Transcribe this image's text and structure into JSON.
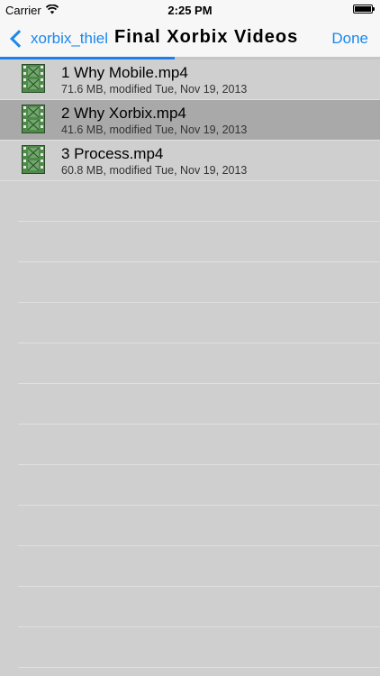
{
  "status_bar": {
    "carrier": "Carrier",
    "time": "2:25 PM",
    "battery_level": 1.0
  },
  "nav": {
    "back_label": "xorbix_thiel",
    "title": "Final Xorbix Videos",
    "done_label": "Done"
  },
  "progress": {
    "value": 0.46
  },
  "files": [
    {
      "name": "1 Why Mobile.mp4",
      "meta": "71.6 MB, modified Tue, Nov 19, 2013",
      "selected": false
    },
    {
      "name": "2 Why Xorbix.mp4",
      "meta": "41.6 MB, modified Tue, Nov 19, 2013",
      "selected": true
    },
    {
      "name": "3 Process.mp4",
      "meta": "60.8 MB, modified Tue, Nov 19, 2013",
      "selected": false
    }
  ],
  "icons": {
    "file": "film-video-file-icon",
    "back": "chevron-left-icon",
    "wifi": "wifi-icon",
    "battery": "battery-icon"
  },
  "colors": {
    "accent": "#1a88ee",
    "selected_row": "#a9a9a9",
    "background": "#cfcfcf",
    "film_green": "#4f8a4b"
  }
}
